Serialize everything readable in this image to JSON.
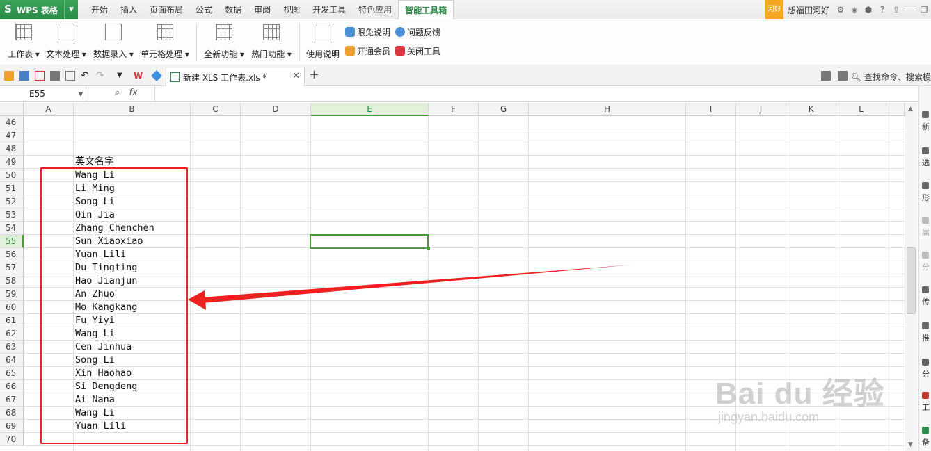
{
  "app": {
    "logo": "S",
    "name": "WPS 表格"
  },
  "menu": {
    "tabs": [
      "开始",
      "插入",
      "页面布局",
      "公式",
      "数据",
      "审阅",
      "视图",
      "开发工具",
      "特色应用",
      "智能工具箱"
    ],
    "active_tab": "智能工具箱",
    "badge": "河好",
    "user": "想福田河好"
  },
  "ribbon": {
    "groups": [
      {
        "label": "工作表 ▾"
      },
      {
        "label": "文本处理 ▾"
      },
      {
        "label": "数据录入 ▾"
      },
      {
        "label": "单元格处理 ▾"
      },
      {
        "label": "全新功能 ▾"
      },
      {
        "label": "热门功能 ▾"
      },
      {
        "label": "使用说明"
      }
    ],
    "small_buttons": [
      "限免说明",
      "问题反馈",
      "开通会员",
      "关闭工具"
    ]
  },
  "doc": {
    "tab_title": "新建 XLS 工作表.xls *",
    "search_placeholder": "查找命令、搜索模"
  },
  "formula": {
    "name_box": "E55",
    "fx": "fx"
  },
  "columns": [
    "A",
    "B",
    "C",
    "D",
    "E",
    "F",
    "G",
    "H",
    "I",
    "J",
    "K",
    "L"
  ],
  "selected_column": "E",
  "rows": [
    "46",
    "47",
    "48",
    "49",
    "50",
    "51",
    "52",
    "53",
    "54",
    "55",
    "56",
    "57",
    "58",
    "59",
    "60",
    "61",
    "62",
    "63",
    "64",
    "65",
    "66",
    "67",
    "68",
    "69",
    "70"
  ],
  "selected_row": "55",
  "cells_B": {
    "header": "英文名字",
    "names": [
      "Wang Li",
      "Li Ming",
      "Song Li",
      "Qin Jia",
      "Zhang Chenchen",
      "Sun Xiaoxiao",
      "Yuan Lili",
      "Du Tingting",
      "Hao Jianjun",
      "An Zhuo",
      "Mo Kangkang",
      "Fu Yiyi",
      "Wang Li",
      "Cen Jinhua",
      "Song Li",
      "Xin Haohao",
      "Si Dengdeng",
      "Ai Nana",
      "Wang Li",
      "Yuan Lili"
    ]
  },
  "sidebar": [
    "新",
    "选",
    "形",
    "属",
    "分",
    "传",
    "推",
    "分",
    "工",
    "备"
  ],
  "watermark": {
    "big": "Bai du 经验",
    "small": "jingyan.baidu.com"
  },
  "colors": {
    "brand": "#2a8a47",
    "selection": "#4a9b3a",
    "annotation": "#f02020"
  }
}
